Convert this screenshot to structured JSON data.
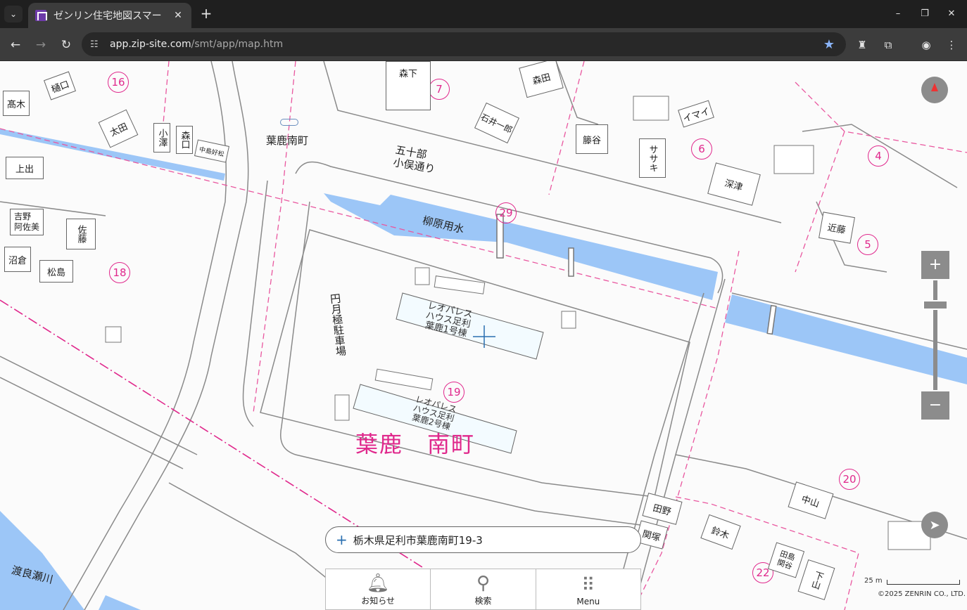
{
  "browser": {
    "tab_title": "ゼンリン住宅地図スマー",
    "tab_close": "✕",
    "new_tab": "+",
    "url_host": "app.zip-site.com",
    "url_path": "/smt/app/map.htm",
    "window_minimize": "–",
    "window_restore": "❐",
    "window_close": "✕"
  },
  "map": {
    "district_name": "葉鹿　南町",
    "station": "葉鹿南町",
    "street": "五十部\n小俣通り",
    "canal": "柳原用水",
    "river": "渡良瀬川",
    "parking": "円月極駐車場",
    "circled_numbers": [
      "16",
      "7",
      "6",
      "4",
      "29",
      "5",
      "18",
      "19",
      "20",
      "22"
    ],
    "buildings": {
      "takagi": "髙木",
      "higuchi": "樋口",
      "ota": "太田",
      "ozawa": "小澤",
      "morita_kou": "森口",
      "nakajima": "中島好松",
      "kamide": "上出",
      "yoshino": "吉野\n阿佐美",
      "sato": "佐藤",
      "numakura": "沼倉",
      "matsushima": "松島",
      "morishita": "森下",
      "morita": "森田",
      "ishii": "石井一郎",
      "fujitani": "籐谷",
      "sasaki": "ササキ",
      "imai": "イマイ",
      "fukatsu": "深津",
      "kondo": "近藤",
      "leopalace1": "レオパレス\nハウス足利\n葉鹿1号棟",
      "leopalace2": "レオパレス\nハウス足利\n葉鹿2号棟",
      "tanaka": "田野",
      "sekiguchi": "関塚",
      "suzuki": "鈴木",
      "nakayama": "中山",
      "shimoyama": "下山",
      "tajima": "田島\n関谷"
    }
  },
  "address": "栃木県足利市葉鹿南町19-3",
  "bottom_menu": {
    "notice": "お知らせ",
    "search": "検索",
    "menu": "Menu"
  },
  "scale_label": "25 m",
  "copyright": "©2025 ZENRIN CO., LTD.",
  "zoom_in": "+",
  "zoom_out": "−"
}
